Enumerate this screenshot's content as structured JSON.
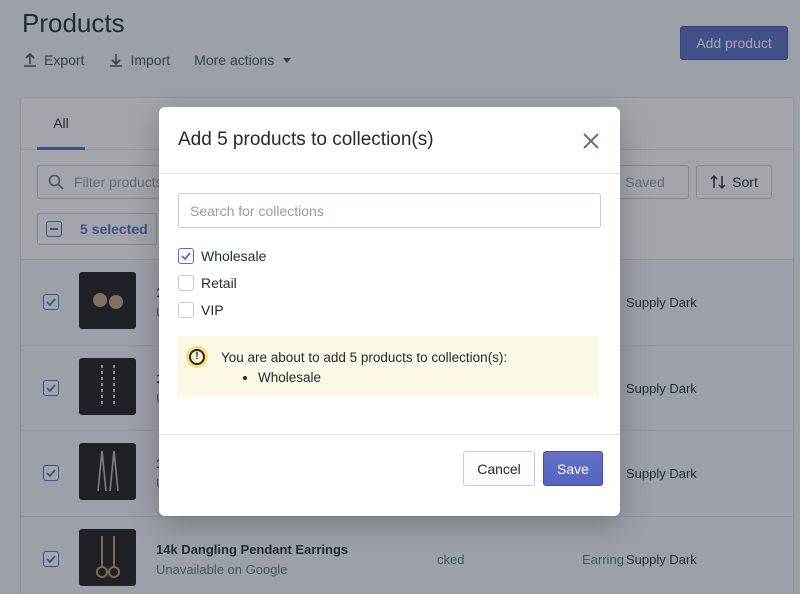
{
  "page": {
    "title": "Products",
    "actions": [
      {
        "label": "Export",
        "icon": "export-icon"
      },
      {
        "label": "Import",
        "icon": "import-icon"
      },
      {
        "label": "More actions",
        "icon": "chevron-down-icon"
      }
    ],
    "add_product_label": "Add product"
  },
  "card": {
    "tab_all": "All",
    "filter_placeholder": "Filter products",
    "saved_label": "Saved",
    "sort_label": "Sort",
    "selected_label": "5 selected",
    "rows": [
      {
        "name": "1",
        "sub": "U",
        "inventory": "",
        "type": "",
        "vendor": "Supply Dark"
      },
      {
        "name": "1",
        "sub": "U",
        "inventory": "",
        "type": "",
        "vendor": "Supply Dark"
      },
      {
        "name": "1",
        "sub": "U",
        "inventory": "",
        "type": "",
        "vendor": "Supply Dark"
      },
      {
        "name": "14k Dangling Pendant Earrings",
        "sub": "Unavailable on Google",
        "inventory": "cked",
        "type": "Earring",
        "vendor": "Supply Dark"
      }
    ]
  },
  "modal": {
    "title": "Add 5 products to collection(s)",
    "search_placeholder": "Search for collections",
    "options": [
      {
        "label": "Wholesale",
        "checked": true
      },
      {
        "label": "Retail",
        "checked": false
      },
      {
        "label": "VIP",
        "checked": false
      }
    ],
    "banner": {
      "message": "You are about to add 5 products to collection(s):",
      "items": [
        "Wholesale"
      ]
    },
    "cancel_label": "Cancel",
    "save_label": "Save"
  },
  "colors": {
    "accent": "#5c6ac4",
    "banner_bg": "#fcf8e6",
    "warning": "#f9dc7b"
  }
}
